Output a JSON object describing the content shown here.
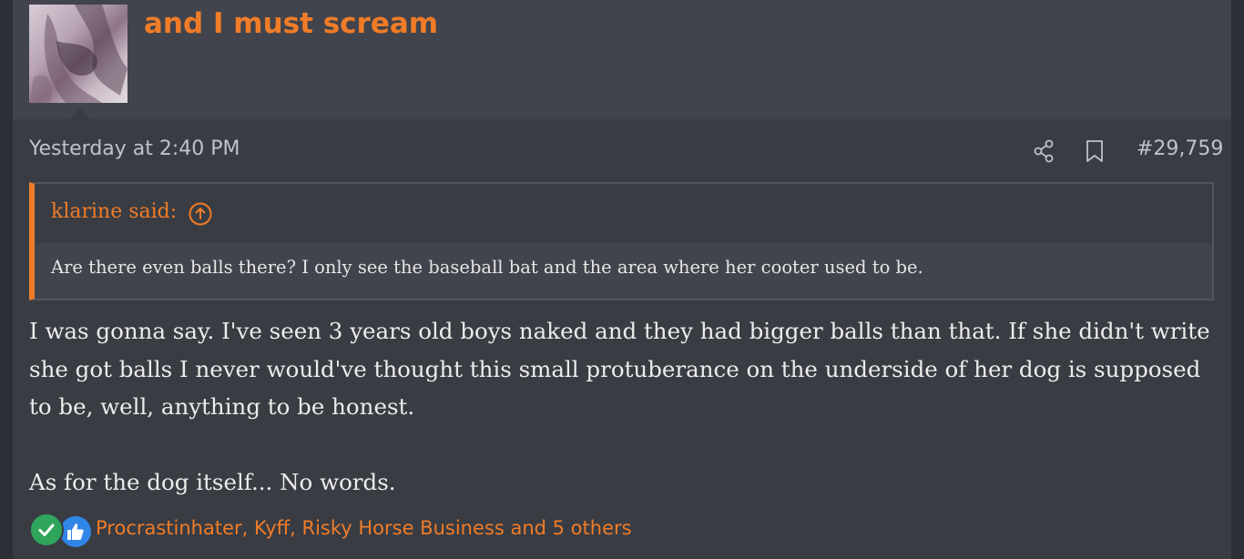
{
  "post": {
    "username": "and I must scream",
    "timestamp": "Yesterday at 2:40 PM",
    "post_number": "#29,759",
    "quote": {
      "author_line": "klarine said:",
      "text": "Are there even balls there? I only see the baseball bat and the area where her cooter used to be."
    },
    "body": {
      "paragraph_1": "I was gonna say. I've seen 3 years old boys naked and they had bigger balls than that. If she didn't write she got balls I never would've thought this small protuberance on the underside of her dog is supposed to be, well, anything to be honest.",
      "paragraph_2": "As for the dog itself... No words."
    },
    "reactions": {
      "types": [
        "check-icon",
        "thumbs-up-icon"
      ],
      "users_text": "Procrastinhater, Kyff, Risky Horse Business and 5 others"
    }
  },
  "colors": {
    "accent": "#f07c28",
    "background": "#393c43",
    "header_background": "#41444c",
    "text": "#ececec",
    "muted_text": "#bfc2c7",
    "like_blue": "#2f86e6",
    "check_green": "#2fa55b"
  }
}
